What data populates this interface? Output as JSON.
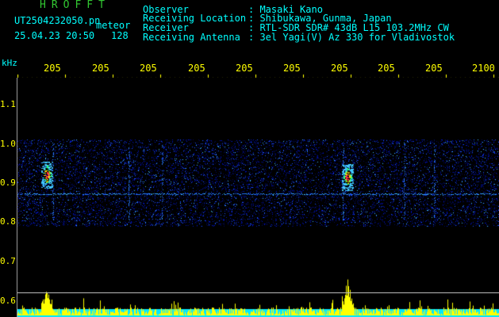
{
  "header": {
    "logo": "HROFFT",
    "filename": "UT2504232050.pn",
    "mode": "meteor",
    "datetime": "25.04.23 20:50",
    "count": "128"
  },
  "station": [
    {
      "label": "Observer",
      "value": ": Masaki Kano"
    },
    {
      "label": "Receiving Location",
      "value": ": Shibukawa, Gunma, Japan"
    },
    {
      "label": "Receiver",
      "value": ": RTL-SDR SDR# 43dB L15 103.2MHz CW"
    },
    {
      "label": "Receiving Antenna",
      "value": ": 3el Yagi(V) Az 330 for Vladivostok"
    }
  ],
  "axis": {
    "unit": "kHz",
    "x_ticks": [
      "205",
      "205",
      "205",
      "205",
      "205",
      "205",
      "205",
      "205",
      "205",
      "2100"
    ],
    "y_ticks": [
      "1.1",
      "1.0",
      "0.9",
      "0.8",
      "0.7",
      "0.6"
    ]
  },
  "colors": {
    "text": "#00ffff",
    "logo": "#32c832",
    "ticks": "#ffff00",
    "signal": "#ffff00",
    "floor": "#00ffff",
    "echo": "#ff2020"
  }
}
